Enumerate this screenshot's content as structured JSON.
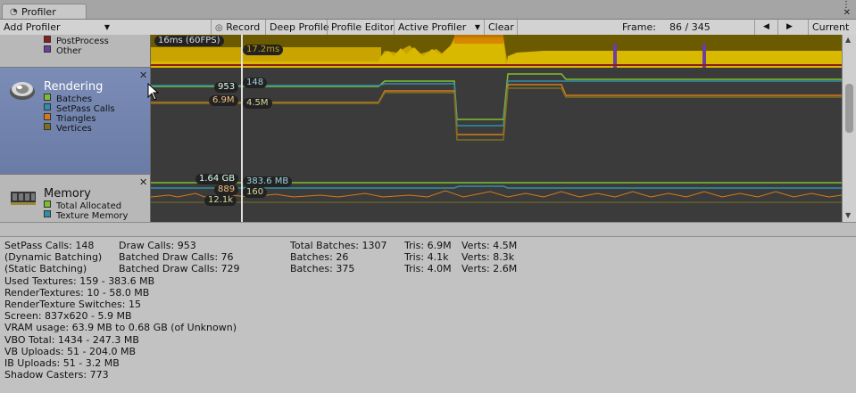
{
  "window": {
    "tab_title": "Profiler",
    "controls": [
      "⋮",
      "✕"
    ]
  },
  "toolbar": {
    "add_profiler": "Add Profiler",
    "record": "Record",
    "deep_profile": "Deep Profile",
    "profile_editor": "Profile Editor",
    "active_profiler": "Active Profiler",
    "clear": "Clear",
    "frame_label": "Frame:",
    "frame_value": "86 / 345",
    "prev": "◀",
    "next": "▶",
    "current": "Current"
  },
  "modules": {
    "cpu_legend": [
      {
        "label": "PostProcess",
        "color": "#8b1d1d"
      },
      {
        "label": "Other",
        "color": "#6a3f9e"
      }
    ],
    "rendering": {
      "title": "Rendering",
      "legend": [
        {
          "label": "Batches",
          "color": "#7fbf2f"
        },
        {
          "label": "SetPass Calls",
          "color": "#2f8fa8"
        },
        {
          "label": "Triangles",
          "color": "#d47a1a"
        },
        {
          "label": "Vertices",
          "color": "#7a7020"
        }
      ]
    },
    "memory": {
      "title": "Memory",
      "legend": [
        {
          "label": "Total Allocated",
          "color": "#7fbf2f"
        },
        {
          "label": "Texture Memory",
          "color": "#2f8fa8"
        }
      ]
    }
  },
  "graph_labels": {
    "cpu_fps": "16ms (60FPS)",
    "cpu_time": "17.2ms",
    "render_batches": "953",
    "render_setpass": "148",
    "render_tris": "6.9M",
    "render_verts": "4.5M",
    "mem_total": "1.64 GB",
    "mem_texture": "383.6 MB",
    "mem_a": "889",
    "mem_b": "160",
    "mem_c": "12.1k"
  },
  "details": {
    "col1": [
      "SetPass Calls: 148",
      "(Dynamic Batching)",
      "(Static Batching)",
      "Used Textures: 159 - 383.6 MB",
      "RenderTextures: 10 - 58.0 MB",
      "RenderTexture Switches: 15",
      "Screen: 837x620 - 5.9 MB",
      "VRAM usage: 63.9 MB to 0.68 GB (of Unknown)",
      "VBO Total: 1434 - 247.3 MB",
      "VB Uploads: 51 - 204.0 MB",
      "IB Uploads: 51 - 3.2 MB",
      "Shadow Casters: 773"
    ],
    "col2": [
      "Draw Calls: 953",
      "Batched Draw Calls: 76",
      "Batched Draw Calls: 729"
    ],
    "col3": [
      "Total Batches: 1307",
      "Batches: 26",
      "Batches: 375"
    ],
    "col4": [
      "Tris: 6.9M",
      "Tris: 4.1k",
      "Tris: 4.0M"
    ],
    "col5": [
      "Verts: 4.5M",
      "Verts: 8.3k",
      "Verts: 2.6M"
    ]
  },
  "colors": {
    "cpu_fill": "#c9a400",
    "cpu_dark": "#7b6700",
    "batches": "#7fbf2f",
    "setpass": "#2f8fa8",
    "triangles": "#d47a1a",
    "vertices": "#7a7020",
    "graph_bg": "#3b3b3b",
    "rendering_panel": "#6f82ad"
  },
  "icons": {
    "profiler_tab": "clock-icon",
    "rendering": "rendering-sphere-icon",
    "memory": "memory-chip-icon",
    "record": "record-icon"
  }
}
